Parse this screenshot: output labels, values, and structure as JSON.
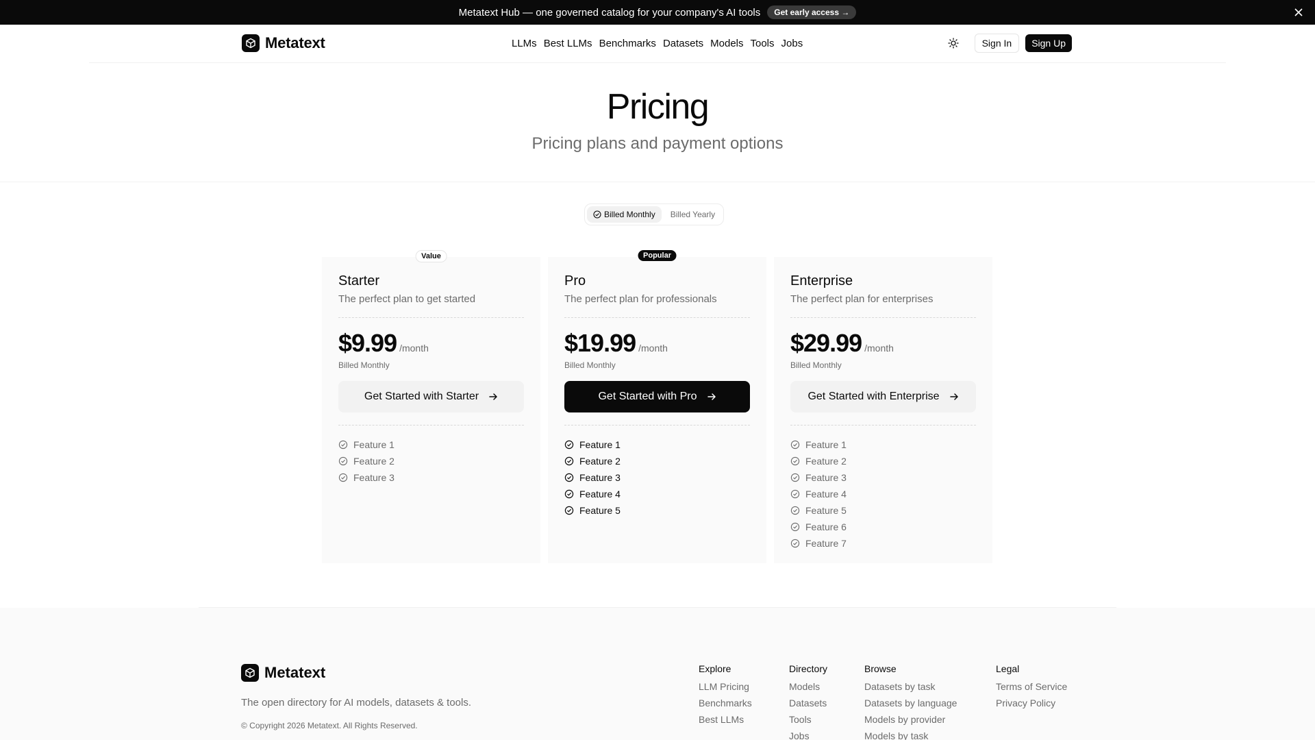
{
  "announcement": {
    "text": "Metatext Hub — one governed catalog for your company's AI tools",
    "cta": "Get early access →"
  },
  "nav": {
    "brand": "Metatext",
    "links": [
      "LLMs",
      "Best LLMs",
      "Benchmarks",
      "Datasets",
      "Models",
      "Tools",
      "Jobs"
    ],
    "sign_in": "Sign In",
    "sign_up": "Sign Up"
  },
  "hero": {
    "title": "Pricing",
    "subtitle": "Pricing plans and payment options"
  },
  "billing_toggle": {
    "monthly": "Billed Monthly",
    "yearly": "Billed Yearly",
    "selected": "monthly"
  },
  "plans": [
    {
      "badge": "Value",
      "name": "Starter",
      "description": "The perfect plan to get started",
      "price": "$9.99",
      "period": "/month",
      "billed": "Billed Monthly",
      "cta": "Get Started with Starter",
      "features": [
        "Feature 1",
        "Feature 2",
        "Feature 3"
      ]
    },
    {
      "badge": "Popular",
      "name": "Pro",
      "description": "The perfect plan for professionals",
      "price": "$19.99",
      "period": "/month",
      "billed": "Billed Monthly",
      "cta": "Get Started with Pro",
      "features": [
        "Feature 1",
        "Feature 2",
        "Feature 3",
        "Feature 4",
        "Feature 5"
      ]
    },
    {
      "badge": "",
      "name": "Enterprise",
      "description": "The perfect plan for enterprises",
      "price": "$29.99",
      "period": "/month",
      "billed": "Billed Monthly",
      "cta": "Get Started with Enterprise",
      "features": [
        "Feature 1",
        "Feature 2",
        "Feature 3",
        "Feature 4",
        "Feature 5",
        "Feature 6",
        "Feature 7"
      ]
    }
  ],
  "footer": {
    "brand": "Metatext",
    "tagline": "The open directory for AI models, datasets & tools.",
    "copyright": "© Copyright 2026 Metatext. All Rights Reserved.",
    "columns": [
      {
        "heading": "Explore",
        "links": [
          "LLM Pricing",
          "Benchmarks",
          "Best LLMs"
        ]
      },
      {
        "heading": "Directory",
        "links": [
          "Models",
          "Datasets",
          "Tools",
          "Jobs"
        ]
      },
      {
        "heading": "Browse",
        "links": [
          "Datasets by task",
          "Datasets by language",
          "Models by provider",
          "Models by task"
        ]
      },
      {
        "heading": "Legal",
        "links": [
          "Terms of Service",
          "Privacy Policy"
        ]
      }
    ]
  },
  "icons": {
    "logo": "cube-icon",
    "close": "close-icon",
    "theme": "sun-icon",
    "check": "check-circle-icon",
    "arrow": "arrow-right-icon"
  }
}
